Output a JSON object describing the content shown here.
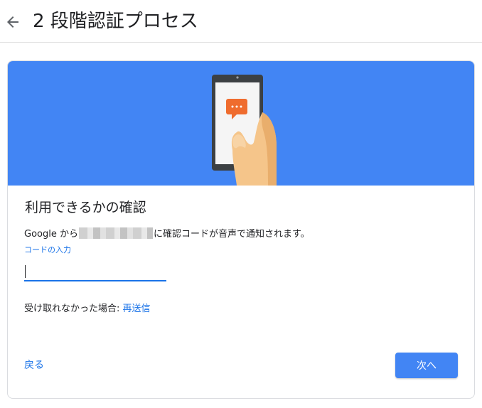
{
  "header": {
    "back_icon": "arrow-left-icon",
    "title": "2 段階認証プロセス"
  },
  "card": {
    "banner_color": "#4285f4",
    "illustration": "phone-with-chat-icon",
    "title": "利用できるかの確認",
    "message_prefix": "Google から",
    "message_suffix": "に確認コードが音声で通知されます。",
    "code_label": "コードの入力",
    "code_value": "",
    "resend_prefix": "受け取れなかった場合: ",
    "resend_link": "再送信",
    "back_label": "戻る",
    "next_label": "次へ"
  },
  "colors": {
    "accent": "#1a73e8",
    "button": "#4285f4"
  }
}
